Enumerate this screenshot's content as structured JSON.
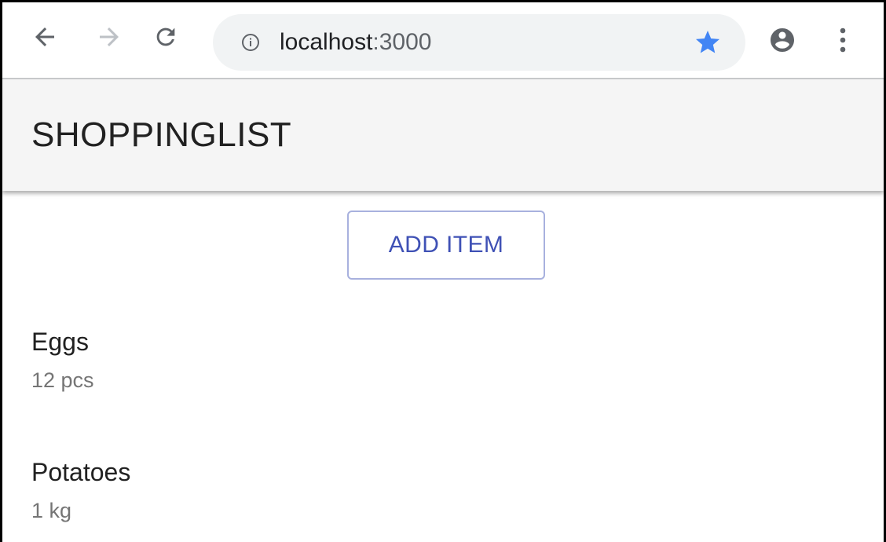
{
  "browser": {
    "url_host": "localhost",
    "url_port": ":3000",
    "icons": {
      "back": "arrow-left-icon",
      "forward": "arrow-right-icon",
      "reload": "reload-icon",
      "info": "info-circle-icon",
      "star": "star-icon",
      "account": "account-circle-icon",
      "menu": "more-vert-icon"
    },
    "colors": {
      "star": "#4285f4",
      "omnibox": "#f1f3f4",
      "icon": "#5f6368",
      "icon_disabled": "#bdc1c6"
    }
  },
  "app": {
    "title": "SHOPPINGLIST",
    "add_item_label": "ADD ITEM",
    "items": [
      {
        "name": "Eggs",
        "quantity": "12 pcs"
      },
      {
        "name": "Potatoes",
        "quantity": "1 kg"
      }
    ],
    "colors": {
      "primary": "#3f51b5",
      "app_bar": "#f5f5f5",
      "secondary_text": "#757575"
    }
  }
}
